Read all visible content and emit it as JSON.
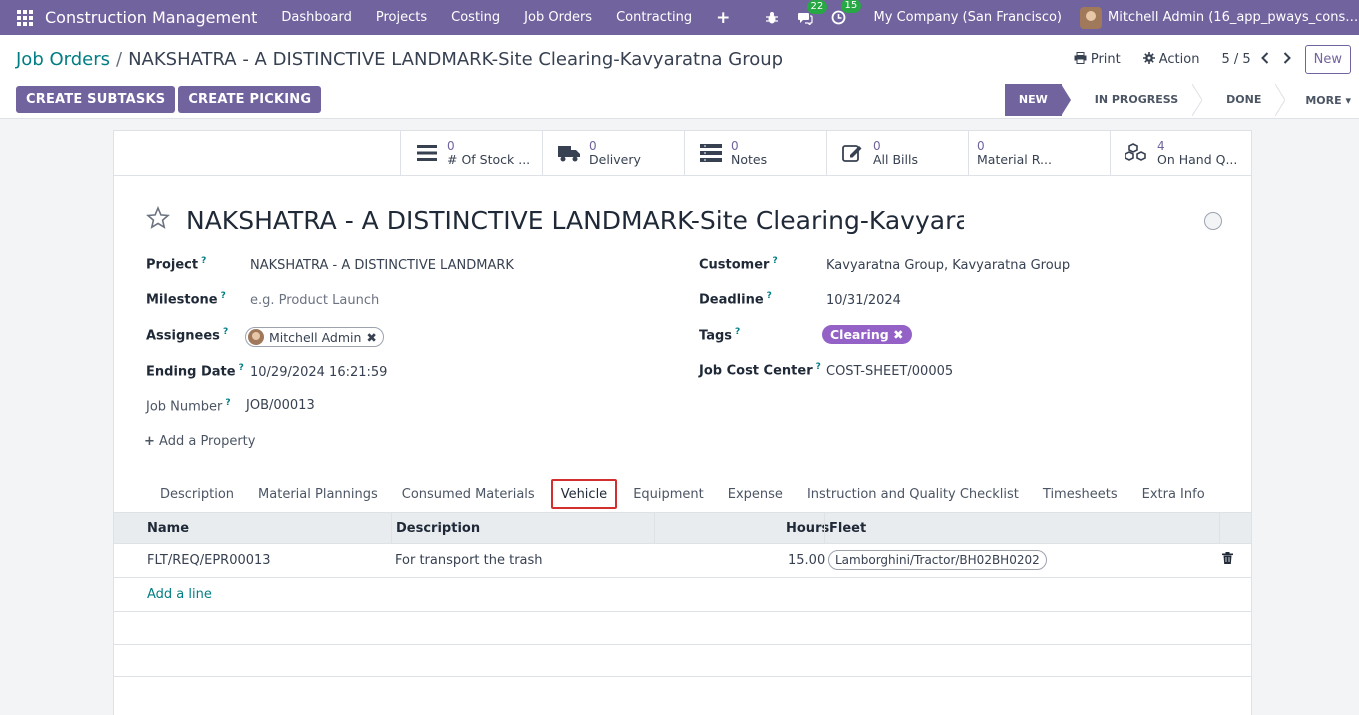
{
  "navbar": {
    "brand": "Construction Management",
    "menu": [
      "Dashboard",
      "Projects",
      "Costing",
      "Job Orders",
      "Contracting"
    ],
    "plus": "+",
    "chat_count": "22",
    "activity_count": "15",
    "company": "My Company (San Francisco)",
    "user": "Mitchell Admin (16_app_pways_const..."
  },
  "control": {
    "breadcrumb_parent": "Job Orders",
    "breadcrumb_sep": "/",
    "breadcrumb_current": "NAKSHATRA - A DISTINCTIVE LANDMARK-Site Clearing-Kavyaratna Group",
    "print_label": "Print",
    "action_label": "Action",
    "pager": "5 / 5",
    "new_label": "New",
    "create_subtasks": "CREATE SUBTASKS",
    "create_picking": "CREATE PICKING",
    "stages": [
      "NEW",
      "IN PROGRESS",
      "DONE"
    ],
    "more_label": "MORE"
  },
  "stats": [
    {
      "num": "0",
      "label": "# Of Stock ...",
      "icon": "bars-icon"
    },
    {
      "num": "0",
      "label": "Delivery",
      "icon": "truck-icon"
    },
    {
      "num": "0",
      "label": "Notes",
      "icon": "notes-icon"
    },
    {
      "num": "0",
      "label": "All Bills",
      "icon": "edit-icon"
    },
    {
      "num": "0",
      "label": "Material R...",
      "icon": "none"
    },
    {
      "num": "4",
      "label": "On Hand Q...",
      "icon": "cubes-icon"
    }
  ],
  "record": {
    "title": "NAKSHATRA - A DISTINCTIVE LANDMARK-Site Clearing-Kavyaratna Group"
  },
  "fields": {
    "project_label": "Project",
    "project_value": "NAKSHATRA - A DISTINCTIVE LANDMARK",
    "milestone_label": "Milestone",
    "milestone_placeholder": "e.g. Product Launch",
    "assignees_label": "Assignees",
    "assignee": "Mitchell Admin",
    "ending_date_label": "Ending Date",
    "ending_date_value": "10/29/2024 16:21:59",
    "job_number_label": "Job Number",
    "job_number_value": "JOB/00013",
    "add_property": "Add a Property",
    "customer_label": "Customer",
    "customer_value": "Kavyaratna Group, Kavyaratna Group",
    "deadline_label": "Deadline",
    "deadline_value": "10/31/2024",
    "tags_label": "Tags",
    "tag_value": "Clearing",
    "cost_center_label": "Job Cost Center",
    "cost_center_value": "COST-SHEET/00005",
    "help_mark": "?"
  },
  "tabs": [
    "Description",
    "Material Plannings",
    "Consumed Materials",
    "Vehicle",
    "Equipment",
    "Expense",
    "Instruction and Quality Checklist",
    "Timesheets",
    "Extra Info"
  ],
  "active_tab": "Vehicle",
  "table": {
    "headers": [
      "Name",
      "Description",
      "Hours",
      "Fleet"
    ],
    "rows": [
      {
        "name": "FLT/REQ/EPR00013",
        "description": "For transport the trash",
        "hours": "15.00",
        "fleet": "Lamborghini/Tractor/BH02BH0202"
      }
    ],
    "add_line": "Add a line"
  },
  "colors": {
    "brand": "#71639e",
    "link": "#017e84",
    "tag": "#9462c7",
    "highlight": "#d32f2f"
  }
}
